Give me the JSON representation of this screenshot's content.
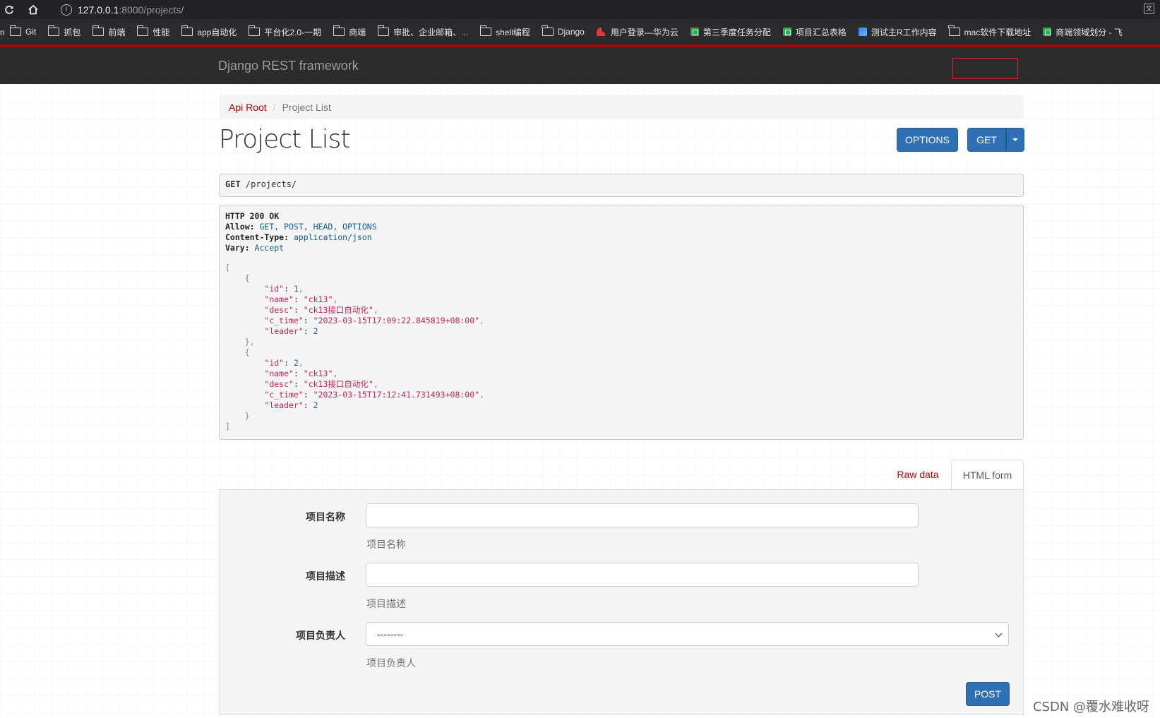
{
  "browser": {
    "url_host": "127.0.0.1",
    "url_path": ":8000/projects/",
    "bookmarks": [
      {
        "label": "Git",
        "icon": "folder"
      },
      {
        "label": "抓包",
        "icon": "folder"
      },
      {
        "label": "前端",
        "icon": "folder"
      },
      {
        "label": "性能",
        "icon": "folder"
      },
      {
        "label": "app自动化",
        "icon": "folder"
      },
      {
        "label": "平台化2.0-一期",
        "icon": "folder"
      },
      {
        "label": "商端",
        "icon": "folder"
      },
      {
        "label": "审批、企业邮箱、...",
        "icon": "folder"
      },
      {
        "label": "shell编程",
        "icon": "folder"
      },
      {
        "label": "Django",
        "icon": "folder"
      },
      {
        "label": "用户登录—华为云",
        "icon": "huawei"
      },
      {
        "label": "第三季度任务分配",
        "icon": "sheet"
      },
      {
        "label": "项目汇总表格",
        "icon": "sheet"
      },
      {
        "label": "测试主R工作内容",
        "icon": "blue"
      },
      {
        "label": "mac软件下载地址",
        "icon": "folder"
      },
      {
        "label": "商端领域划分 - 飞",
        "icon": "sheet"
      }
    ]
  },
  "navbar": {
    "brand": "Django REST framework"
  },
  "breadcrumb": {
    "root": "Api Root",
    "sep": "/",
    "current": "Project List"
  },
  "page": {
    "title": "Project List",
    "options_label": "OPTIONS",
    "get_label": "GET"
  },
  "request": {
    "method": "GET",
    "path": " /projects/"
  },
  "response": {
    "status": "HTTP 200 OK",
    "headers": [
      {
        "name": "Allow:",
        "value": " GET, POST, HEAD, OPTIONS"
      },
      {
        "name": "Content-Type:",
        "value": " application/json"
      },
      {
        "name": "Vary:",
        "value": " Accept"
      }
    ],
    "items": [
      {
        "id": 1,
        "name": "ck13",
        "desc": "ck13接口自动化",
        "c_time": "2023-03-15T17:09:22.845819+08:00",
        "leader": 2
      },
      {
        "id": 2,
        "name": "ck13",
        "desc": "ck13接口自动化",
        "c_time": "2023-03-15T17:12:41.731493+08:00",
        "leader": 2
      }
    ]
  },
  "tabs": {
    "raw": "Raw data",
    "html": "HTML form"
  },
  "form": {
    "name_label": "项目名称",
    "name_help": "项目名称",
    "desc_label": "项目描述",
    "desc_help": "项目描述",
    "leader_label": "项目负责人",
    "leader_value": "--------",
    "leader_help": "项目负责人",
    "post_label": "POST"
  },
  "watermark": "CSDN @覆水难收呀",
  "colors": {
    "accent": "#2f6fb4",
    "link": "#c20000",
    "navbar": "#2c2c2c",
    "strip": "#a30000"
  }
}
